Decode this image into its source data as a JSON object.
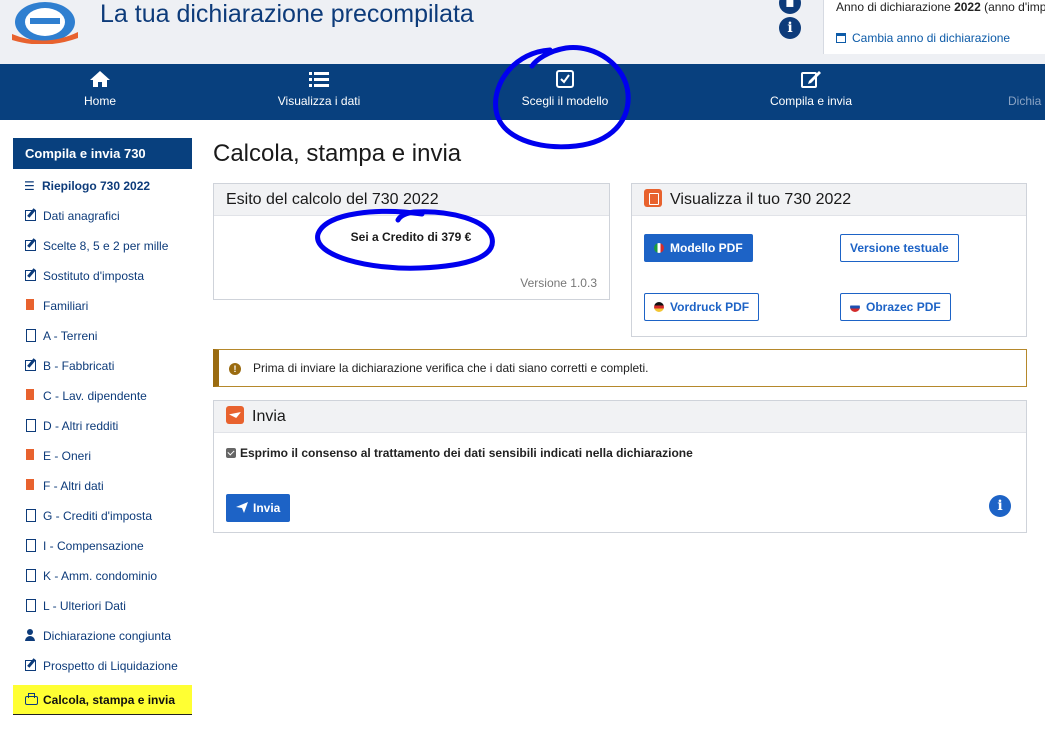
{
  "header": {
    "title": "La tua dichiarazione precompilata",
    "year_prefix": "Anno di dichiarazione ",
    "year": "2022",
    "year_suffix": " (anno d'imp",
    "change_year_link": "Cambia anno di dichiarazione",
    "icons": [
      "clipboard-icon",
      "info-icon"
    ]
  },
  "nav": {
    "items": [
      {
        "label": "Home",
        "icon": "home-icon"
      },
      {
        "label": "Visualizza i dati",
        "icon": "list-icon"
      },
      {
        "label": "Scegli il modello",
        "icon": "check-square-icon"
      },
      {
        "label": "Compila e invia",
        "icon": "edit-icon"
      },
      {
        "label": "Dichia",
        "icon": ""
      }
    ]
  },
  "sidebar": {
    "heading": "Compila e invia 730",
    "items": [
      {
        "label": "Riepilogo 730 2022",
        "icon": "list-icon"
      },
      {
        "label": "Dati anagrafici",
        "icon": "edit-icon"
      },
      {
        "label": "Scelte 8, 5 e 2 per mille",
        "icon": "edit-icon"
      },
      {
        "label": "Sostituto d'imposta",
        "icon": "edit-icon"
      },
      {
        "label": "Familiari",
        "icon": "pdf-file-icon"
      },
      {
        "label": "A - Terreni",
        "icon": "file-icon"
      },
      {
        "label": "B - Fabbricati",
        "icon": "edit-icon"
      },
      {
        "label": "C - Lav. dipendente",
        "icon": "pdf-file-icon"
      },
      {
        "label": "D - Altri redditi",
        "icon": "file-icon"
      },
      {
        "label": "E - Oneri",
        "icon": "pdf-file-icon"
      },
      {
        "label": "F - Altri dati",
        "icon": "pdf-file-icon"
      },
      {
        "label": "G - Crediti d'imposta",
        "icon": "file-icon"
      },
      {
        "label": "I - Compensazione",
        "icon": "file-icon"
      },
      {
        "label": "K - Amm. condominio",
        "icon": "file-icon"
      },
      {
        "label": "L - Ulteriori Dati",
        "icon": "file-icon"
      },
      {
        "label": "Dichiarazione congiunta",
        "icon": "user-icon"
      },
      {
        "label": "Prospetto di Liquidazione",
        "icon": "edit-icon"
      },
      {
        "label": "Calcola, stampa e invia",
        "icon": "print-icon"
      }
    ]
  },
  "main": {
    "title": "Calcola, stampa e invia",
    "esito": {
      "heading": "Esito del calcolo del 730 2022",
      "result": "Sei a Credito di 379 €",
      "version": "Versione 1.0.3"
    },
    "visualizza": {
      "heading": "Visualizza il tuo 730 2022",
      "modello_pdf": "Modello PDF",
      "versione_testuale": "Versione testuale",
      "vordruck_pdf": "Vordruck PDF",
      "obrazec_pdf": "Obrazec PDF"
    },
    "alert": "Prima di inviare la dichiarazione verifica che i dati siano corretti e completi.",
    "invia": {
      "heading": "Invia",
      "consent": "Esprimo il consenso al trattamento dei dati sensibili indicati nella dichiarazione",
      "button": "Invia"
    }
  },
  "colors": {
    "nav_bg": "#08407e",
    "primary": "#1d63c6",
    "accent_orange": "#e8622e",
    "annotation_blue": "#0000ee",
    "annotation_yellow": "#ffff33"
  }
}
